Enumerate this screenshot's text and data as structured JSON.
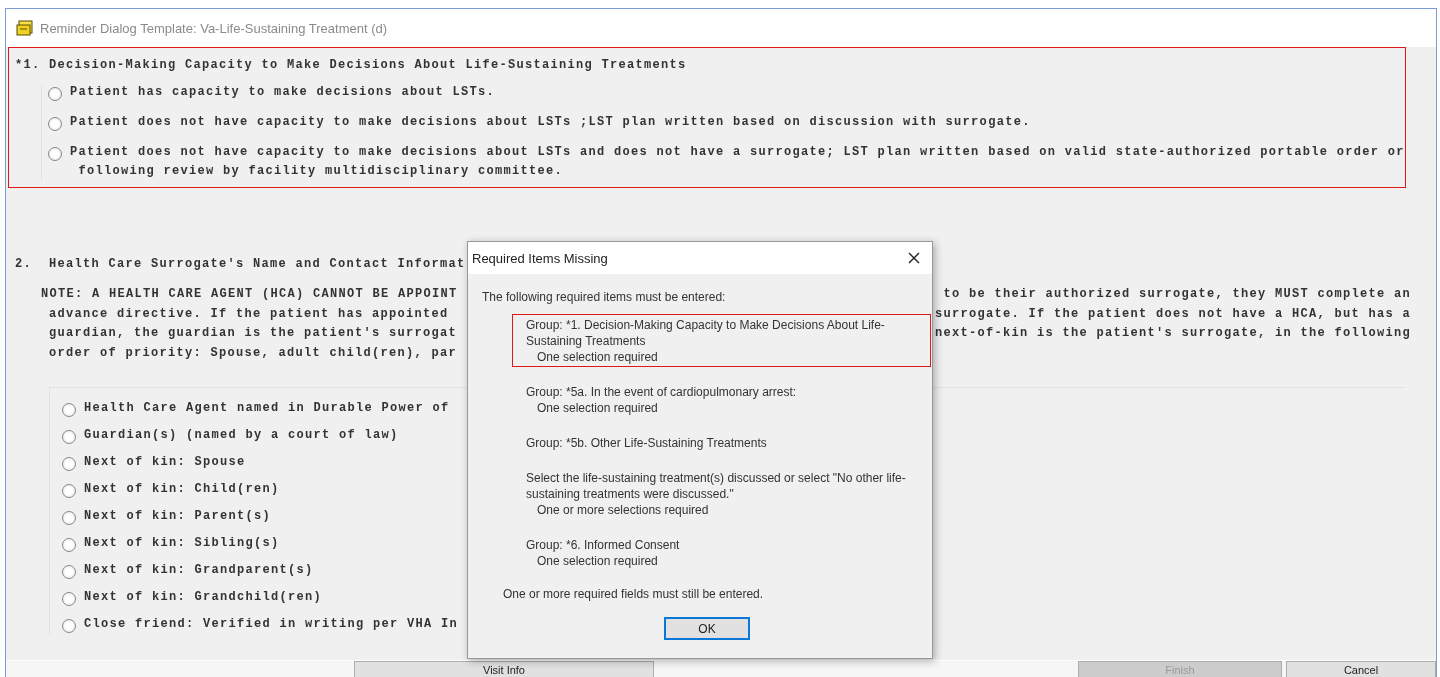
{
  "window": {
    "title": "Reminder Dialog Template: Va-Life-Sustaining Treatment (d)"
  },
  "sections": [
    {
      "title": "*1. Decision-Making Capacity to Make Decisions About Life-Sustaining Treatments",
      "highlighted": true,
      "options": [
        {
          "lines": [
            "Patient has capacity to make decisions about LSTs."
          ],
          "checked": false
        },
        {
          "lines": [
            "Patient does not have capacity to make decisions about LSTs ;LST plan written based on discussion with surrogate."
          ],
          "checked": false
        },
        {
          "lines": [
            "Patient does not have capacity to make decisions about LSTs and does not have a surrogate; LST plan written based on valid state-authorized portable order or",
            "following review by facility multidisciplinary committee."
          ],
          "checked": false
        }
      ]
    },
    {
      "title": "2.  Health Care Surrogate's Name and Contact Informat",
      "highlighted": false,
      "note_lines": [
        {
          "left": "NOTE: A HEALTH CARE AGENT (HCA) CANNOT BE APPOINT",
          "right": "to be their authorized surrogate, they MUST complete an"
        },
        {
          "left": "advance directive. If the patient has appointed",
          "right": "surrogate. If the patient does not have a HCA, but has a"
        },
        {
          "left": "guardian, the guardian is the patient's surrogat",
          "right": "next-of-kin is the patient's surrogate, in the following"
        },
        {
          "left": "order of priority: Spouse, adult child(ren), par"
        }
      ],
      "options": [
        {
          "lines": [
            "Health Care Agent named in Durable Power of"
          ],
          "checked": false
        },
        {
          "lines": [
            "Guardian(s) (named by a court of law)"
          ],
          "checked": false
        },
        {
          "lines": [
            "Next of kin: Spouse"
          ],
          "checked": false
        },
        {
          "lines": [
            "Next of kin: Child(ren)"
          ],
          "checked": false
        },
        {
          "lines": [
            "Next of kin: Parent(s)"
          ],
          "checked": false
        },
        {
          "lines": [
            "Next of kin: Sibling(s)"
          ],
          "checked": false
        },
        {
          "lines": [
            "Next of kin: Grandparent(s)"
          ],
          "checked": false
        },
        {
          "lines": [
            "Next of kin: Grandchild(ren)"
          ],
          "checked": false
        },
        {
          "lines": [
            "Close friend: Verified in writing per VHA In"
          ],
          "checked": false
        }
      ]
    }
  ],
  "bottom_buttons": [
    {
      "label": "Visit Info",
      "disabled": false
    },
    {
      "label": "Finish",
      "disabled": true
    },
    {
      "label": "Cancel",
      "disabled": false
    }
  ],
  "dialog": {
    "title": "Required Items Missing",
    "intro": "The following required items must be entered:",
    "items": [
      {
        "lines": [
          "Group: *1. Decision-Making Capacity to Make Decisions About Life-Sustaining Treatments"
        ],
        "requirement": "One selection required",
        "highlighted": true
      },
      {
        "lines": [
          "Group: *5a. In the event of cardiopulmonary arrest:"
        ],
        "requirement": "One selection required",
        "highlighted": false
      },
      {
        "lines": [
          "Group: *5b. Other Life-Sustaining Treatments"
        ],
        "highlighted": false
      },
      {
        "lines": [
          "Select the life-sustaining treatment(s) discussed or select \"No other life-sustaining treatments were discussed.\""
        ],
        "requirement": "One or more selections required",
        "highlighted": false
      },
      {
        "lines": [
          "Group: *6. Informed Consent"
        ],
        "requirement": "One selection required",
        "highlighted": false
      }
    ],
    "footer": "One or more required fields must still be entered.",
    "ok_label": "OK"
  }
}
